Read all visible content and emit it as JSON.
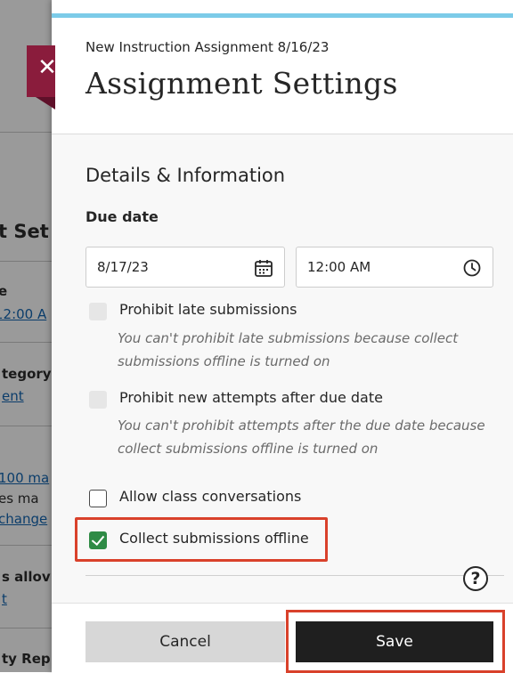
{
  "background": {
    "fragments": [
      "t Set",
      "e",
      "12:00 A",
      "tegory",
      "ent",
      "100 ma",
      "es ma",
      "change",
      "s allov",
      "t",
      "ty Rep"
    ]
  },
  "close_tab": {
    "icon": "close-icon",
    "symbol": "✕",
    "color": "#8a1c3c"
  },
  "header": {
    "breadcrumb": "New Instruction Assignment 8/16/23",
    "title": "Assignment Settings",
    "accent_color": "#7ccbe8"
  },
  "details": {
    "section_title": "Details & Information",
    "due_label": "Due date",
    "date_value": "8/17/23",
    "time_value": "12:00 AM",
    "date_icon": "calendar-icon",
    "time_icon": "clock-icon"
  },
  "options": {
    "prohibit_late": {
      "label": "Prohibit late submissions",
      "hint": "You can't prohibit late submissions because collect submissions offline is turned on",
      "checked": false,
      "disabled": true
    },
    "prohibit_attempts": {
      "label": "Prohibit new attempts after due date",
      "hint": "You can't prohibit attempts after the due date because collect submissions offline is turned on",
      "checked": false,
      "disabled": true
    },
    "class_conversations": {
      "label": "Allow class conversations",
      "checked": false,
      "disabled": false
    },
    "collect_offline": {
      "label": "Collect submissions offline",
      "checked": true,
      "disabled": false,
      "check_color": "#2e8b45"
    }
  },
  "help": {
    "icon": "help-icon",
    "symbol": "?"
  },
  "footer": {
    "cancel_label": "Cancel",
    "save_label": "Save"
  },
  "highlight_color": "#d9412b"
}
